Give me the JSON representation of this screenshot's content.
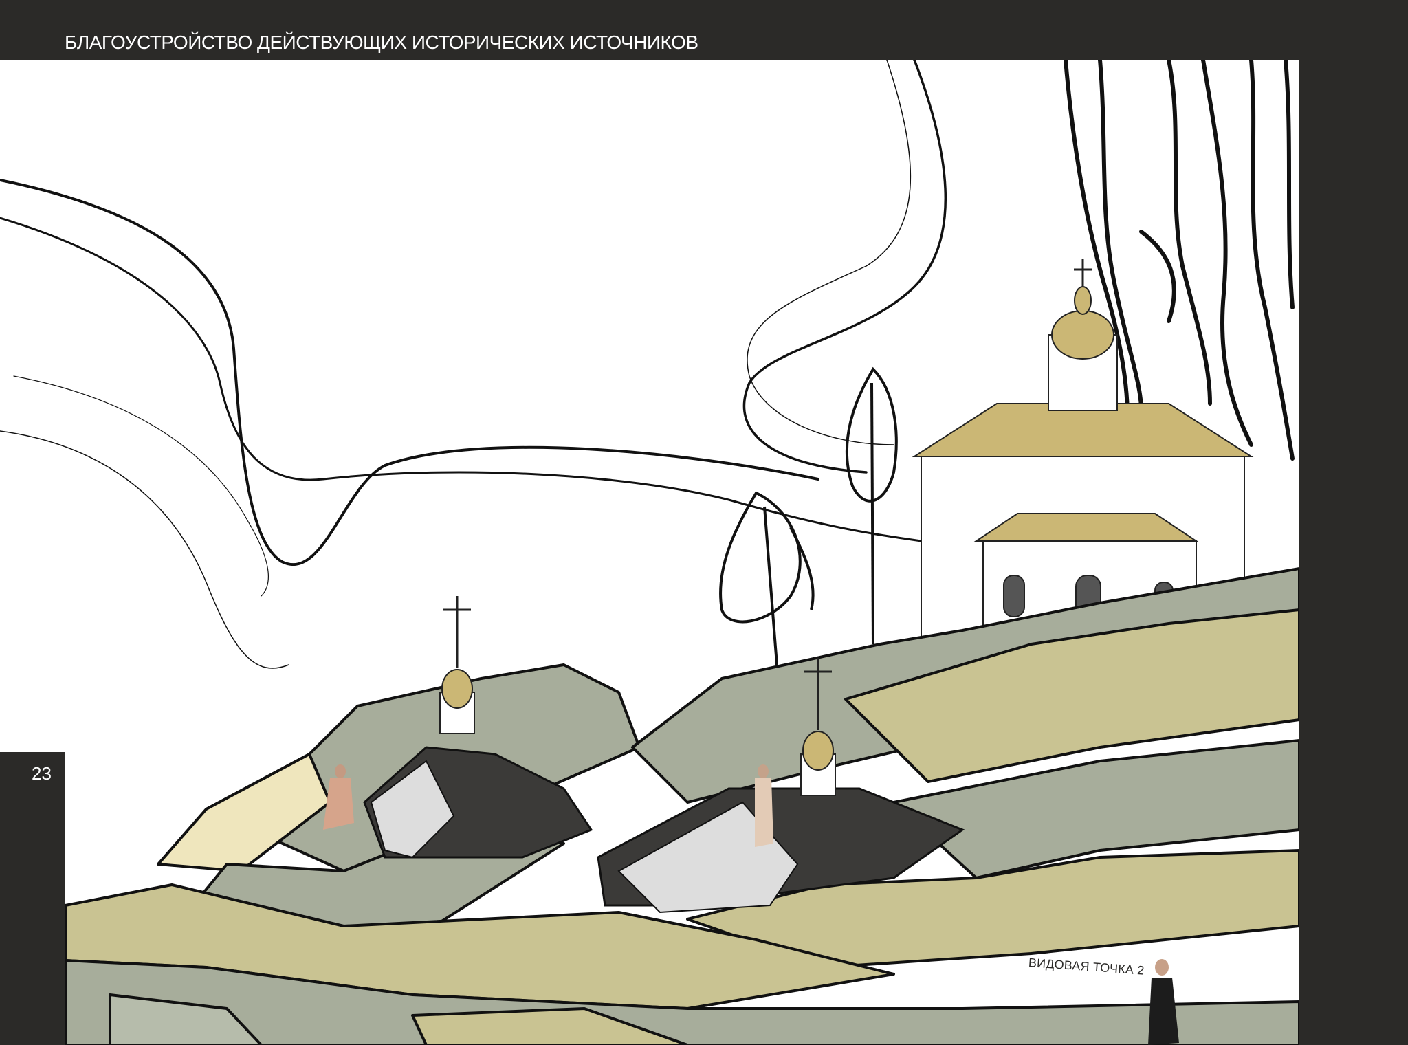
{
  "header": {
    "title": "БЛАГОУСТРОЙСТВО ДЕЙСТВУЮЩИХ ИСТОРИЧЕСКИХ ИСТОЧНИКОВ"
  },
  "page": {
    "number": "23"
  },
  "illustration": {
    "viewpoint_label": "ВИДОВАЯ ТОЧКА 2"
  },
  "colors": {
    "frame": "#2b2a28",
    "sage": "#a7ad9b",
    "olive": "#c9c392",
    "pale_yellow": "#efe6bd",
    "gold": "#cbb775",
    "dark_green": "#7f8771",
    "line": "#111111"
  }
}
